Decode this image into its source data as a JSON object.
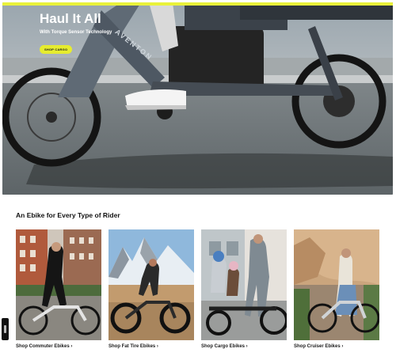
{
  "hero": {
    "title": "Haul It All",
    "subtitle": "With Torque Sensor Technology",
    "cta_label": "SHOP CARGO",
    "frame_brand": "AVENTON",
    "accent_color": "#e6ec2f"
  },
  "section": {
    "title": "An Ebike for Every Type of Rider"
  },
  "cards": [
    {
      "link_label": "Shop Commuter Ebikes ›",
      "scene": "city-commuter"
    },
    {
      "link_label": "Shop Fat Tire Ebikes ›",
      "scene": "mountain-desert"
    },
    {
      "link_label": "Shop Cargo Ebikes ›",
      "scene": "family-cargo"
    },
    {
      "link_label": "Shop Cruiser Ebikes ›",
      "scene": "canyon-cruiser"
    }
  ],
  "side_tab": {
    "icon": "chat-icon"
  }
}
